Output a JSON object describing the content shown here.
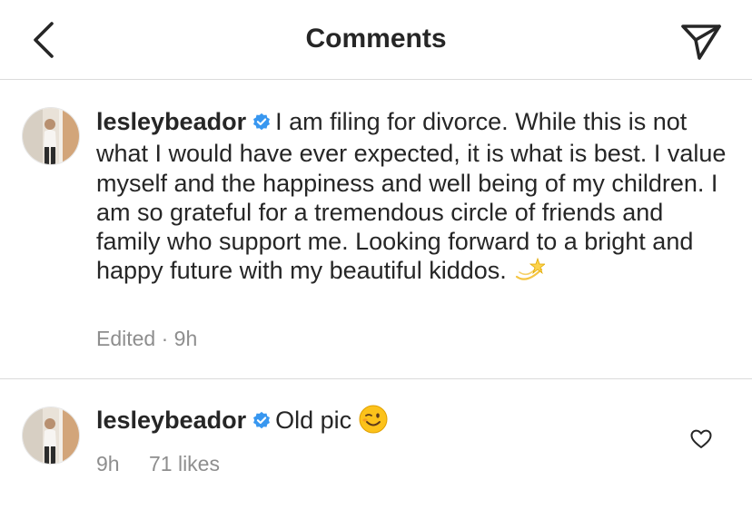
{
  "header": {
    "title": "Comments",
    "back_icon": "chevron-left-icon",
    "share_icon": "paper-plane-icon"
  },
  "comments": [
    {
      "username": "lesleybeador",
      "verified": true,
      "text": "I am filing for divorce. While this is not what I would have ever expected, it is what is best. I value myself and the happiness and well being of my children. I am so grateful for a tremendous circle of friends and family who support me. Looking forward to a bright and happy future with my beautiful kiddos.",
      "emoji": "dizzy-star-emoji",
      "edited": "Edited",
      "separator": "·",
      "time": "9h"
    },
    {
      "username": "lesleybeador",
      "verified": true,
      "text": "Old pic",
      "emoji": "winking-face-emoji",
      "time": "9h",
      "likes": "71 likes",
      "like_icon": "heart-outline-icon"
    }
  ],
  "colors": {
    "text": "#262626",
    "muted": "#8e8e8e",
    "verified": "#3897f0",
    "divider": "#dbdbdb"
  }
}
